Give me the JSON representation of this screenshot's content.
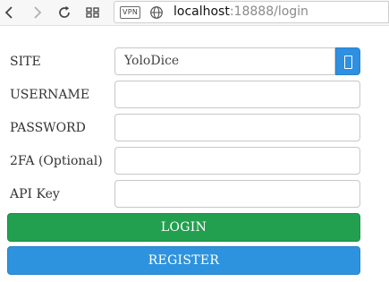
{
  "browser": {
    "url_host": "localhost",
    "url_path": ":18888/login",
    "vpn_label": "VPN",
    "icons": [
      "back-icon",
      "forward-icon",
      "reload-icon",
      "apps-grid-icon",
      "globe-icon"
    ]
  },
  "form": {
    "site": {
      "label": "SITE",
      "value": "YoloDice"
    },
    "username": {
      "label": "USERNAME",
      "value": ""
    },
    "password": {
      "label": "PASSWORD",
      "value": ""
    },
    "twofa": {
      "label": "2FA (Optional)",
      "value": ""
    },
    "apikey": {
      "label": "API Key",
      "value": ""
    },
    "login_label": "LOGIN",
    "register_label": "REGISTER"
  },
  "colors": {
    "login": "#22a050",
    "register": "#2e93de",
    "select_button": "#2f8fe0"
  }
}
